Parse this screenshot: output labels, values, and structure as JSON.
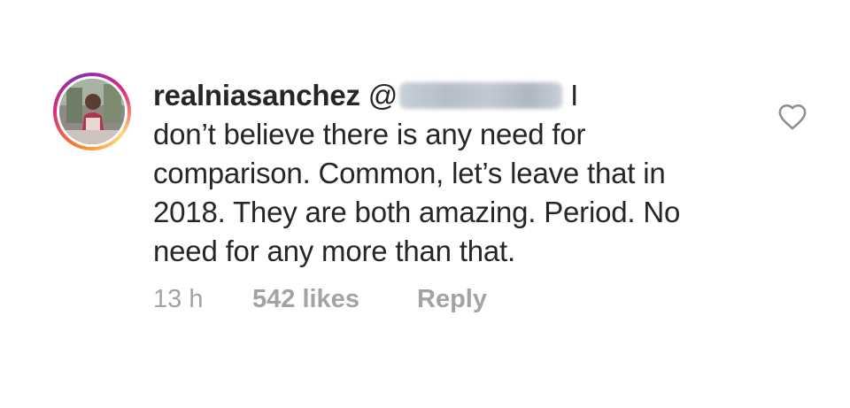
{
  "comment": {
    "username": "realniasanchez",
    "mention_prefix": "@",
    "body_first": "I",
    "body_rest": "don’t believe there is any need for comparison. Common, let’s leave that in 2018. They are both amazing. Period. No need for any more than that.",
    "time": "13 h",
    "likes": "542 likes",
    "reply_label": "Reply"
  },
  "icons": {
    "like": "heart-outline-icon",
    "avatar": "profile-picture"
  },
  "colors": {
    "text": "#262626",
    "meta": "#a3a3a3",
    "story_ring": "#dd2a7b"
  }
}
